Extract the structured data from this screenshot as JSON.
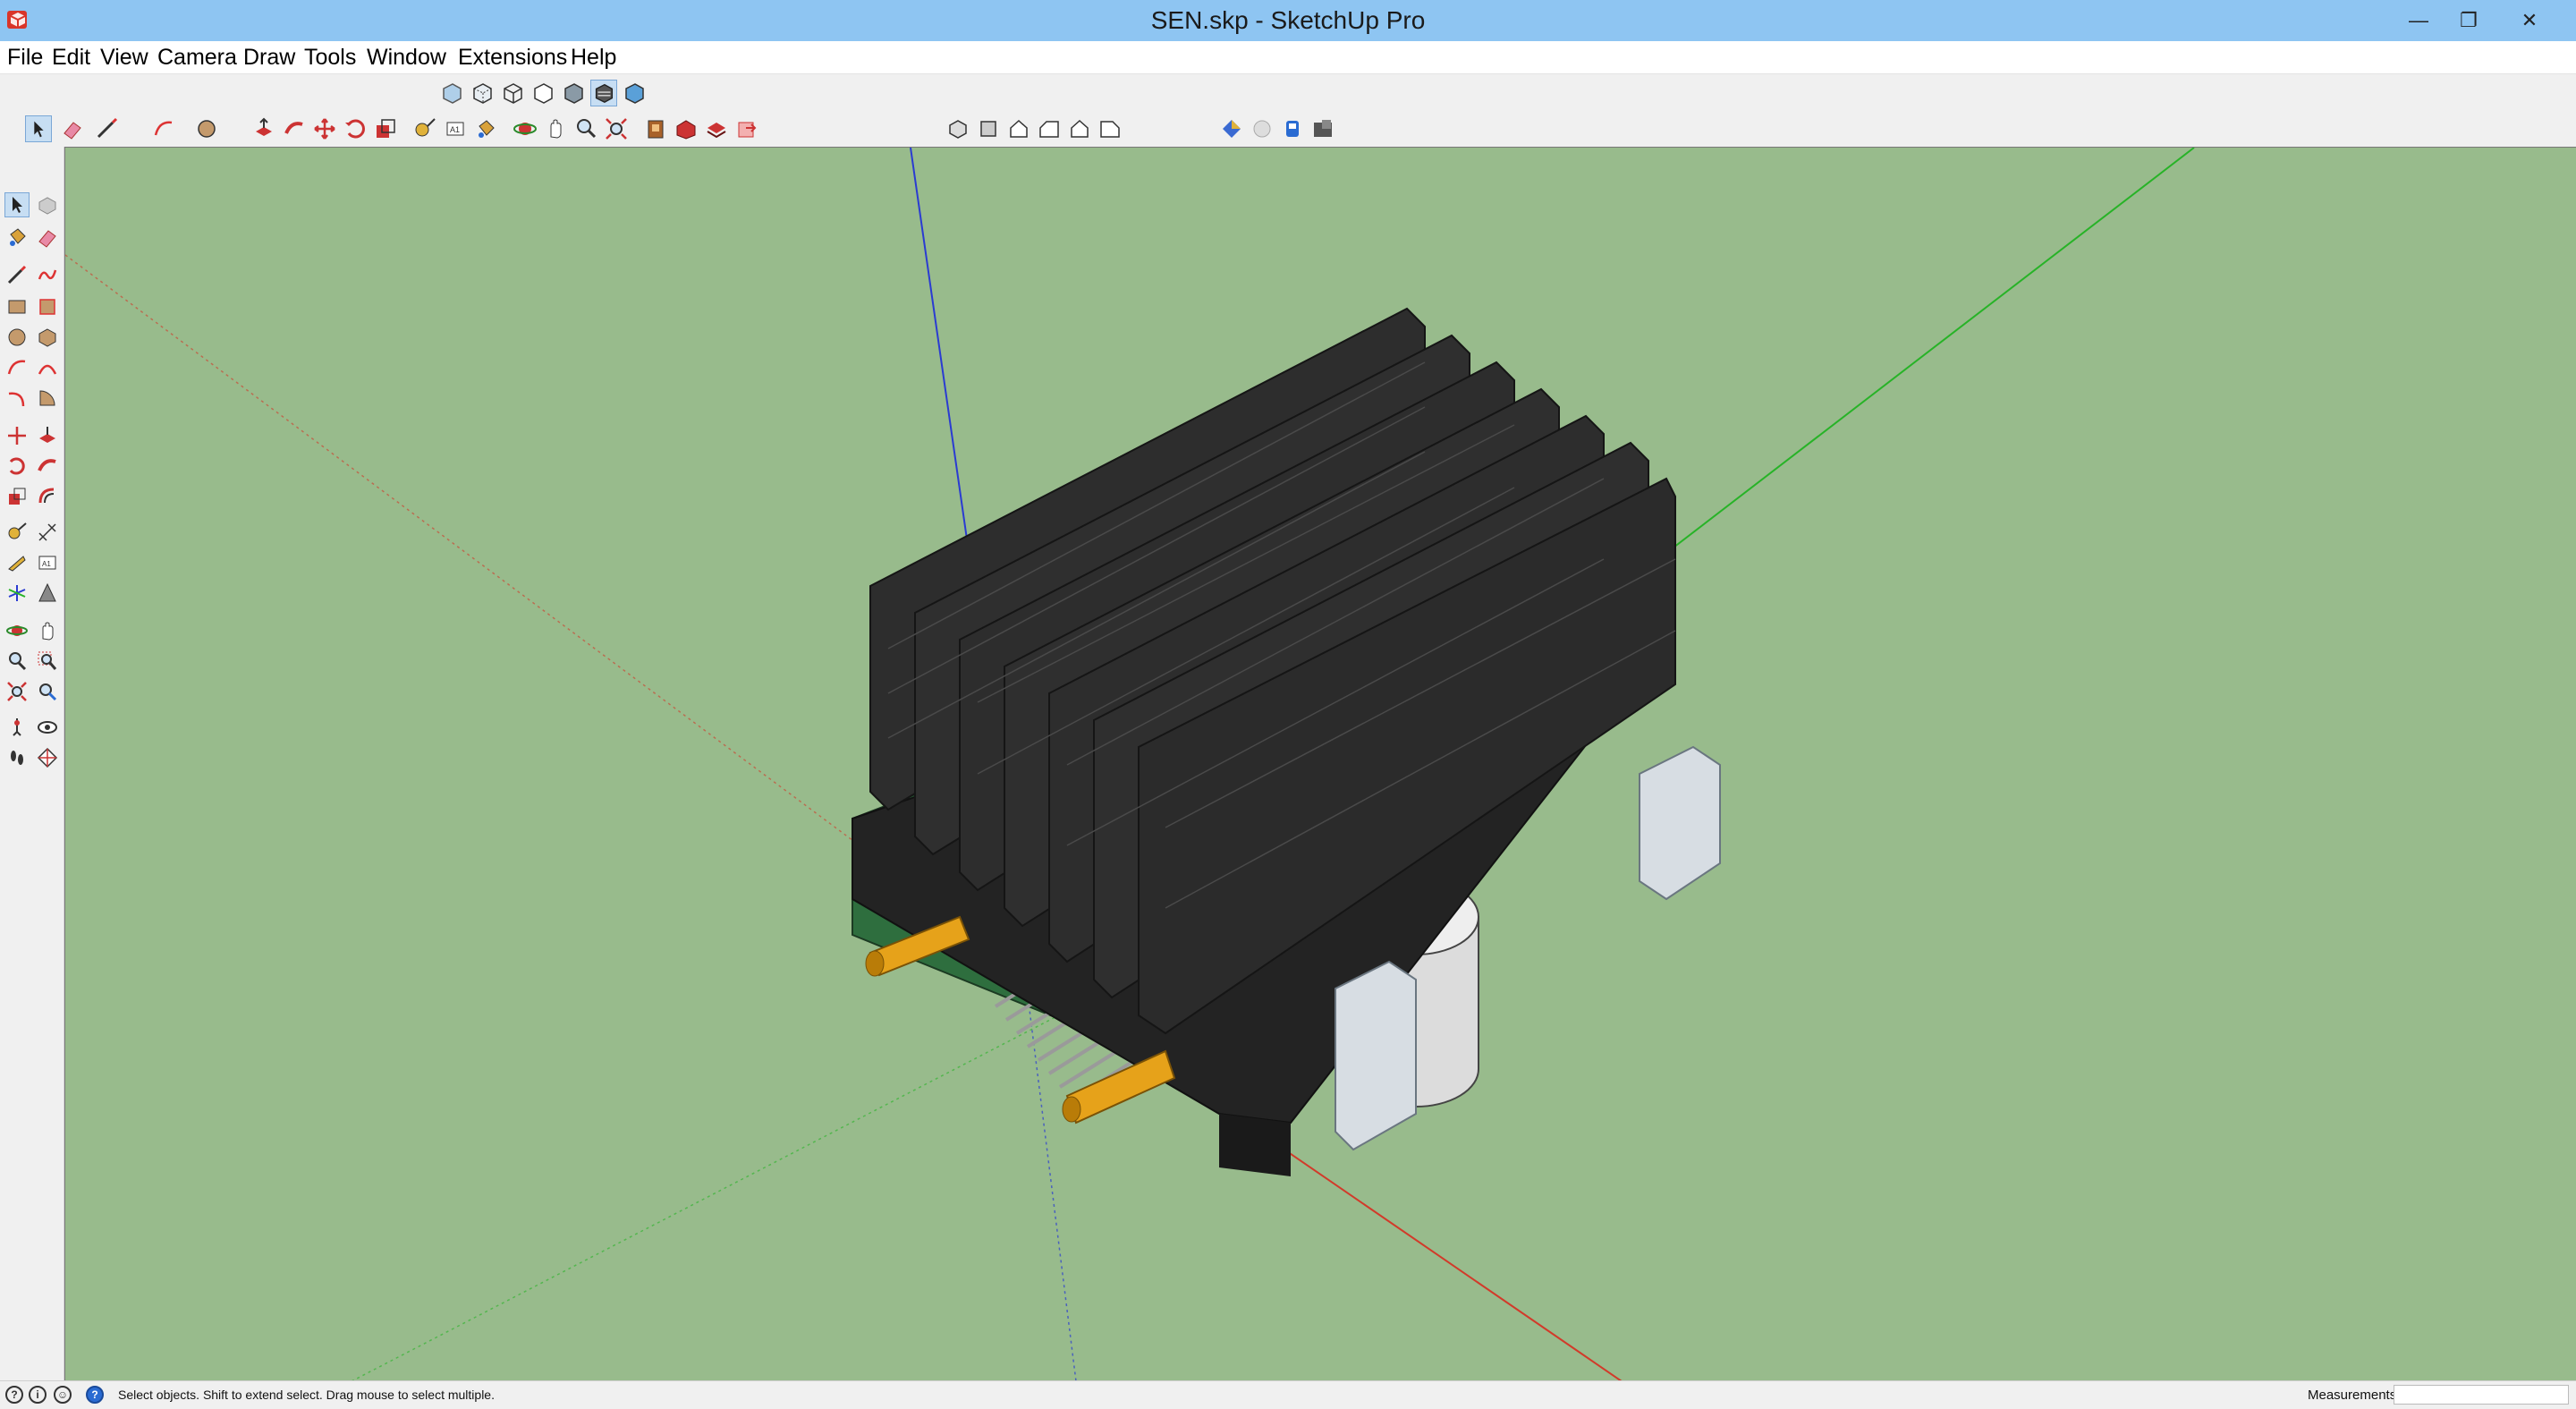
{
  "window": {
    "title": "SEN.skp - SketchUp Pro",
    "minimize_glyph": "—",
    "restore_glyph": "❐",
    "close_glyph": "✕"
  },
  "menu": {
    "items": [
      "File",
      "Edit",
      "View",
      "Camera",
      "Draw",
      "Tools",
      "Window",
      "Extensions",
      "Help"
    ]
  },
  "colors": {
    "titlebar": "#8ec5f2",
    "viewport_background": "#98bb8c",
    "axis_red": "#d23a2a",
    "axis_green": "#27b327",
    "axis_blue": "#2a3bd2",
    "heatsink": "#2d2d2d",
    "pcb": "#2e6e3e",
    "standoff": "#e6a21a",
    "clip": "#d7dde3",
    "cylinder": "#dedede"
  },
  "toolbars": {
    "styles": [
      "xray-icon",
      "back-edges-icon",
      "wireframe-icon",
      "hidden-line-icon",
      "shaded-icon",
      "shaded-textures-icon",
      "monochrome-icon"
    ],
    "styles_active": "shaded-textures-icon",
    "main": [
      "select-icon",
      "eraser-icon",
      "line-icon",
      "arc-icon",
      "circle-icon",
      "push-pull-icon",
      "follow-me-icon",
      "move-icon",
      "rotate-icon",
      "scale-icon",
      "tape-measure-icon",
      "text-icon",
      "paint-bucket-icon",
      "orbit-icon",
      "pan-icon",
      "zoom-icon",
      "zoom-extents-icon",
      "warehouse-icon",
      "extension-warehouse-icon",
      "layout-icon",
      "send-to-layout-icon"
    ],
    "views": [
      "iso-view-icon",
      "top-view-icon",
      "front-view-icon",
      "right-view-icon",
      "back-view-icon",
      "left-view-icon"
    ],
    "extra": [
      "sandbox-icon",
      "geo-location-icon",
      "solid-tools-icon",
      "dynamic-components-icon"
    ]
  },
  "left_toolbar": [
    "select-icon",
    "component-icon",
    "paint-bucket-icon",
    "eraser-icon",
    "line-icon",
    "freehand-icon",
    "rectangle-icon",
    "rotated-rectangle-icon",
    "circle-icon",
    "polygon-icon",
    "arc-icon",
    "two-point-arc-icon",
    "three-point-arc-icon",
    "pie-icon",
    "move-icon",
    "push-pull-icon",
    "rotate-icon",
    "follow-me-icon",
    "scale-icon",
    "offset-icon",
    "tape-measure-icon",
    "dimension-icon",
    "protractor-icon",
    "text-icon",
    "axes-icon",
    "3d-text-icon",
    "orbit-icon",
    "pan-icon",
    "zoom-icon",
    "zoom-window-icon",
    "zoom-extents-icon",
    "previous-view-icon",
    "position-camera-icon",
    "look-around-icon",
    "walk-icon",
    "section-plane-icon"
  ],
  "status": {
    "hint": "Select objects. Shift to extend select. Drag mouse to select multiple.",
    "measurements_label": "Measurements",
    "measurements_value": ""
  }
}
